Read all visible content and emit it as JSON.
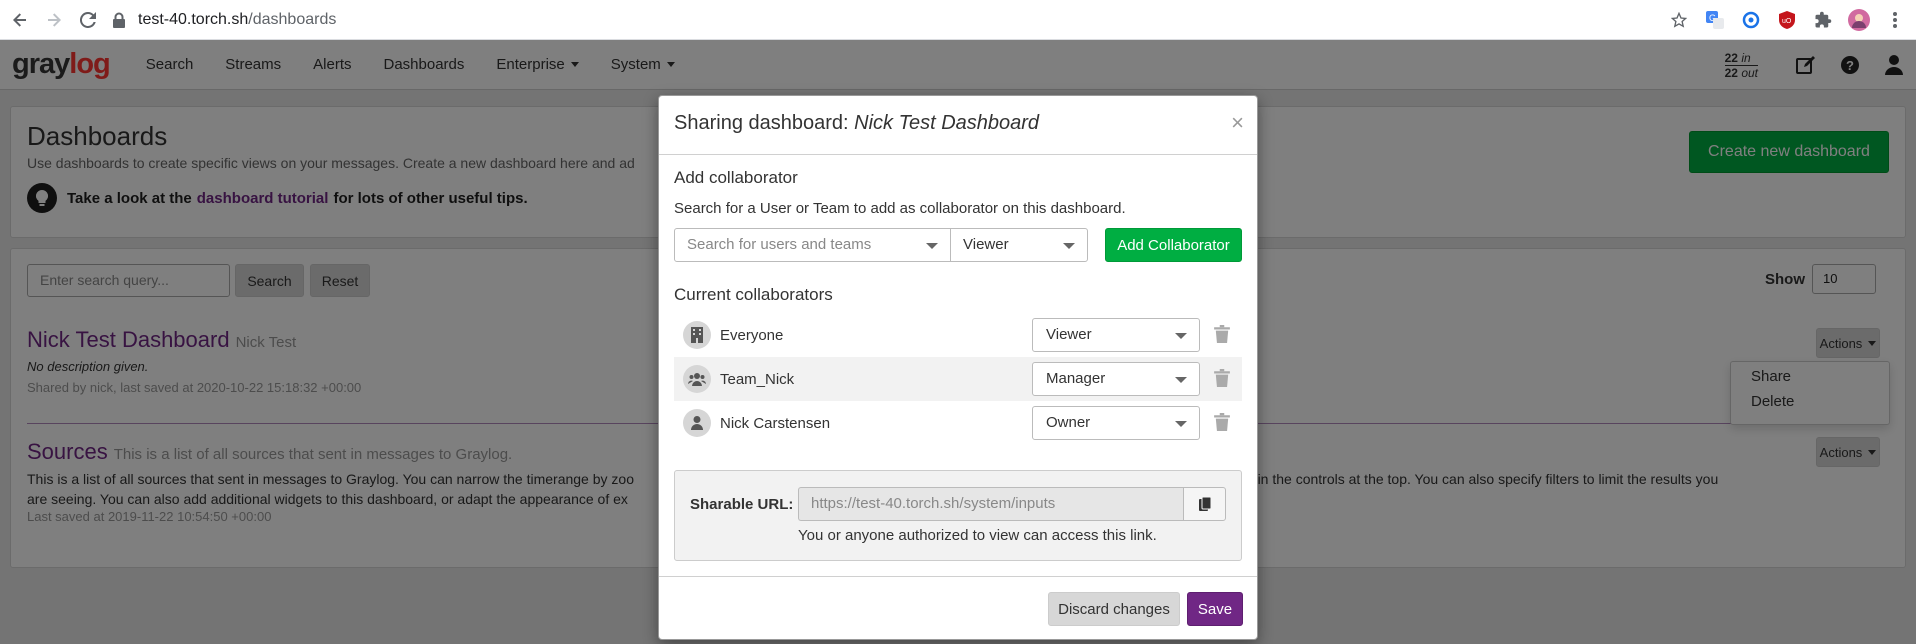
{
  "browser": {
    "url_host": "test-40.torch.sh",
    "url_path": "/dashboards",
    "icons": [
      "back-icon",
      "forward-icon",
      "reload-icon",
      "lock-icon",
      "star-icon",
      "translate-icon",
      "extension-icon",
      "ublock-icon",
      "puzzle-icon",
      "profile-avatar-icon",
      "menu-kebab-icon"
    ]
  },
  "navbar": {
    "logo_main": "gray",
    "logo_accent": "log",
    "links": [
      "Search",
      "Streams",
      "Alerts",
      "Dashboards",
      "Enterprise",
      "System"
    ],
    "throughput_in_value": "22",
    "throughput_in_label": "in",
    "throughput_out_value": "22",
    "throughput_out_label": "out"
  },
  "page": {
    "title": "Dashboards",
    "description": "Use dashboards to create specific views on your messages. Create a new dashboard here and ad",
    "tip_prefix": "Take a look at the",
    "tip_link": "dashboard tutorial",
    "tip_suffix": "for lots of other useful tips.",
    "create_button": "Create new dashboard",
    "search_placeholder": "Enter search query...",
    "search_button": "Search",
    "reset_button": "Reset",
    "show_label": "Show",
    "show_value": "10",
    "dashboards": [
      {
        "title": "Nick Test Dashboard",
        "owner": "Nick Test",
        "description": "No description given.",
        "meta": "Shared by nick, last saved at 2020-10-22 15:18:32 +00:00",
        "actions_label": "Actions"
      },
      {
        "title": "Sources",
        "subtitle": "This is a list of all sources that sent in messages to Graylog.",
        "description_left": "This is a list of all sources that sent in messages to Graylog. You can narrow the timerange by zoo",
        "description_right": "er one in the controls at the top. You can also specify filters to limit the results you",
        "description_line2": "are seeing. You can also add additional widgets to this dashboard, or adapt the appearance of ex",
        "meta": "Last saved at 2019-11-22 10:54:50 +00:00",
        "actions_label": "Actions"
      }
    ],
    "actions_menu": [
      "Share",
      "Delete"
    ]
  },
  "modal": {
    "title_prefix": "Sharing dashboard:",
    "title_name": "Nick Test Dashboard",
    "close": "×",
    "add_title": "Add collaborator",
    "add_desc": "Search for a User or Team to add as collaborator on this dashboard.",
    "search_placeholder": "Search for users and teams",
    "role_select": "Viewer",
    "add_button": "Add Collaborator",
    "current_title": "Current collaborators",
    "collaborators": [
      {
        "name": "Everyone",
        "role": "Viewer",
        "icon": "building-icon"
      },
      {
        "name": "Team_Nick",
        "role": "Manager",
        "icon": "users-icon"
      },
      {
        "name": "Nick Carstensen",
        "role": "Owner",
        "icon": "user-icon"
      }
    ],
    "share_label": "Sharable URL:",
    "share_url": "https://test-40.torch.sh/system/inputs",
    "share_help": "You or anyone authorized to view can access this link.",
    "discard_button": "Discard changes",
    "save_button": "Save"
  },
  "colors": {
    "accent_purple": "#702785",
    "success_green": "#00ae42",
    "logo_red": "#ff3633"
  }
}
